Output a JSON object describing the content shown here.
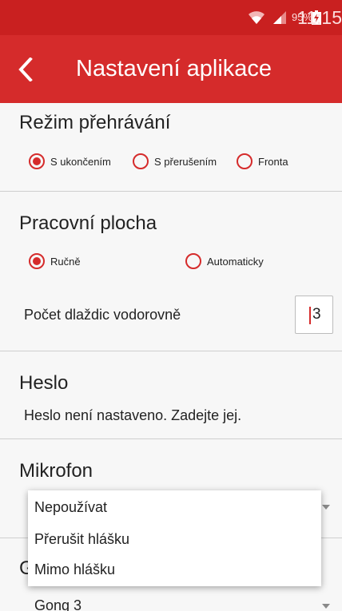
{
  "status_bar": {
    "battery_percent": "95%",
    "time": "11:15",
    "icons": [
      "wifi-icon",
      "signal-icon",
      "battery-charging-icon"
    ]
  },
  "app_bar": {
    "title": "Nastavení aplikace",
    "back_icon": "chevron-left-icon"
  },
  "playback_mode": {
    "title": "Režim přehrávání",
    "options": [
      "S ukončením",
      "S přerušením",
      "Fronta"
    ],
    "selected_index": 0
  },
  "desktop": {
    "title": "Pracovní plocha",
    "options": [
      "Ručně",
      "Automaticky"
    ],
    "selected_index": 0,
    "tiles_label": "Počet dlaždic vodorovně",
    "tiles_value": "3"
  },
  "password": {
    "title": "Heslo",
    "status": "Heslo není nastaveno. Zadejte jej."
  },
  "microphone": {
    "title": "Mikrofon",
    "options": [
      "Nepoužívat",
      "Přerušit hlášku",
      "Mimo hlášku"
    ]
  },
  "gong": {
    "title_partial": "G",
    "value": "Gong 3"
  },
  "colors": {
    "status_bar": "#c92020",
    "app_bar": "#d52b2b",
    "accent": "#d52b2b",
    "background": "#f7f7f7"
  }
}
